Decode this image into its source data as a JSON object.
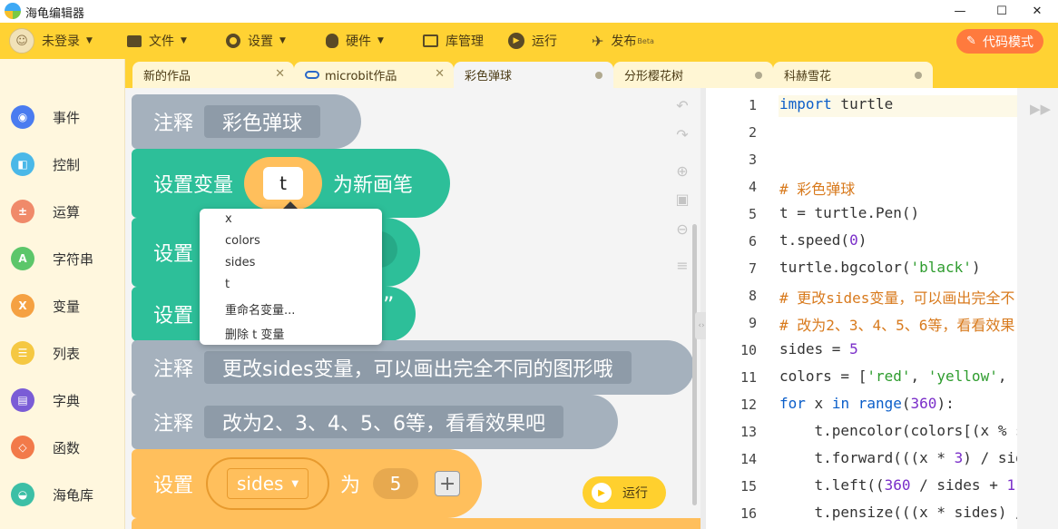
{
  "window": {
    "title": "海龟编辑器",
    "minimize": "—",
    "maximize": "☐",
    "close": "✕"
  },
  "menubar": {
    "user": "未登录",
    "file": "文件",
    "settings": "设置",
    "hardware": "硬件",
    "library": "库管理",
    "run": "运行",
    "publish": "发布",
    "publish_badge": "Beta",
    "code_mode": "代码模式"
  },
  "tabs": [
    {
      "label": "新的作品",
      "close": "✕"
    },
    {
      "label": "microbit作品",
      "close": "✕"
    },
    {
      "label": "彩色弹球"
    },
    {
      "label": "分形樱花树"
    },
    {
      "label": "科赫雪花"
    }
  ],
  "categories": [
    {
      "label": "事件",
      "color": "#4a7cf0",
      "glyph": "◉"
    },
    {
      "label": "控制",
      "color": "#4ab8e8",
      "glyph": "◧"
    },
    {
      "label": "运算",
      "color": "#f08a6a",
      "glyph": "±"
    },
    {
      "label": "字符串",
      "color": "#5cc66a",
      "glyph": "A"
    },
    {
      "label": "变量",
      "color": "#f5a142",
      "glyph": "X"
    },
    {
      "label": "列表",
      "color": "#f5c842",
      "glyph": "☰"
    },
    {
      "label": "字典",
      "color": "#7a5cd6",
      "glyph": "▤"
    },
    {
      "label": "函数",
      "color": "#f27a4a",
      "glyph": "◇"
    },
    {
      "label": "海龟库",
      "color": "#3cbfa6",
      "glyph": "◒"
    }
  ],
  "blocks": {
    "comment1_kw": "注释",
    "comment1_text": "彩色弹球",
    "setvar_kw": "设置变量",
    "setvar_value": "t",
    "setvar_tail": "为新画笔",
    "set2_kw": "设置",
    "set3_kw": "设置",
    "set3_tail": "”",
    "comment2_kw": "注释",
    "comment2_text": "更改sides变量，可以画出完全不同的图形哦",
    "comment3_kw": "注释",
    "comment3_text": "改为2、3、4、5、6等，看看效果吧",
    "set_sides_kw": "设置",
    "set_sides_var": "sides",
    "set_sides_to": "为",
    "set_sides_value": "5",
    "plus": "+"
  },
  "dropdown": [
    "x",
    "colors",
    "sides",
    "t",
    "重命名变量...",
    "删除 t 变量"
  ],
  "workspace_tools": {
    "undo": "↶",
    "redo": "↷",
    "zoom_in": "⊕",
    "reset": "▣",
    "zoom_out": "⊖",
    "cleanup": "≡"
  },
  "run_button": "运行",
  "code": {
    "line_numbers": [
      "1",
      "2",
      "3",
      "4",
      "5",
      "6",
      "7",
      "8",
      "9",
      "10",
      "11",
      "12",
      "13",
      "14",
      "15",
      "16"
    ],
    "lines": [
      [
        {
          "t": "import",
          "c": "k"
        },
        {
          "t": " turtle",
          "c": ""
        }
      ],
      [],
      [],
      [
        {
          "t": "# 彩色弹球",
          "c": "cm"
        }
      ],
      [
        {
          "t": "t = turtle.Pen()",
          "c": ""
        }
      ],
      [
        {
          "t": "t.speed(",
          "c": ""
        },
        {
          "t": "0",
          "c": "n"
        },
        {
          "t": ")",
          "c": ""
        }
      ],
      [
        {
          "t": "turtle.bgcolor(",
          "c": ""
        },
        {
          "t": "'black'",
          "c": "s"
        },
        {
          "t": ")",
          "c": ""
        }
      ],
      [
        {
          "t": "# 更改sides变量，可以画出完全不",
          "c": "cm"
        }
      ],
      [
        {
          "t": "# 改为2、3、4、5、6等，看看效果",
          "c": "cm"
        }
      ],
      [
        {
          "t": "sides = ",
          "c": ""
        },
        {
          "t": "5",
          "c": "n"
        }
      ],
      [
        {
          "t": "colors = [",
          "c": ""
        },
        {
          "t": "'red'",
          "c": "s"
        },
        {
          "t": ", ",
          "c": ""
        },
        {
          "t": "'yellow'",
          "c": "s"
        },
        {
          "t": ",",
          "c": ""
        }
      ],
      [
        {
          "t": "for",
          "c": "k"
        },
        {
          "t": " x ",
          "c": ""
        },
        {
          "t": "in",
          "c": "k"
        },
        {
          "t": " ",
          "c": ""
        },
        {
          "t": "range",
          "c": "k"
        },
        {
          "t": "(",
          "c": ""
        },
        {
          "t": "360",
          "c": "n"
        },
        {
          "t": "):",
          "c": ""
        }
      ],
      [
        {
          "t": "    t.pencolor(colors[(x % s",
          "c": ""
        }
      ],
      [
        {
          "t": "    t.forward(((x * ",
          "c": ""
        },
        {
          "t": "3",
          "c": "n"
        },
        {
          "t": ") / sid",
          "c": ""
        }
      ],
      [
        {
          "t": "    t.left((",
          "c": ""
        },
        {
          "t": "360",
          "c": "n"
        },
        {
          "t": " / sides + ",
          "c": ""
        },
        {
          "t": "1",
          "c": "n"
        },
        {
          "t": ")",
          "c": ""
        }
      ],
      [
        {
          "t": "    t.pensize(((x * sides) /",
          "c": ""
        }
      ]
    ]
  },
  "code_panel": {
    "collapse": "‹›",
    "expand": "▶▶"
  },
  "colors": {
    "accent_yellow": "#ffd233",
    "code_mode_orange": "#ff7a3d",
    "block_gray": "#a5b1bd",
    "block_teal": "#2dbf99",
    "block_orange": "#ffbf5c"
  }
}
